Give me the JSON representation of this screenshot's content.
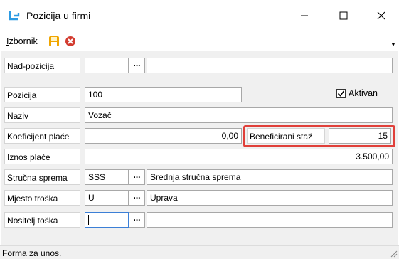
{
  "window": {
    "title": "Pozicija u firmi",
    "icon": "app-icon",
    "controls": [
      "minimize-icon",
      "maximize-icon",
      "close-icon"
    ]
  },
  "menu": {
    "accel": "I",
    "rest": "zbornik",
    "icons": [
      "save-icon",
      "cancel-icon"
    ]
  },
  "form": {
    "nad_pozicija": {
      "label": "Nad-pozicija",
      "code": "",
      "name": ""
    },
    "pozicija": {
      "label": "Pozicija",
      "value": "100"
    },
    "aktivan": {
      "label": "Aktivan",
      "checked": true
    },
    "naziv": {
      "label": "Naziv",
      "value": "Vozač"
    },
    "koeficijent": {
      "label": "Koeficijent plaće",
      "value": "0,00"
    },
    "beneficirani": {
      "label": "Beneficirani staž",
      "value": "15"
    },
    "iznos": {
      "label": "Iznos plaće",
      "value": "3.500,00"
    },
    "strucna": {
      "label": "Stručna sprema",
      "code": "SSS",
      "name": "Srednja stručna sprema"
    },
    "mjesto": {
      "label": "Mjesto troška",
      "code": "U",
      "name": "Uprava"
    },
    "nositelj": {
      "label": "Nositelj toška",
      "code": "",
      "name": ""
    },
    "ellipsis": "..."
  },
  "status": {
    "text": "Forma za unos."
  },
  "colors": {
    "highlight": "#e0403a",
    "app_icon": "#2d9be3",
    "save_icon": "#f0a500",
    "cancel_icon": "#d33b2f"
  }
}
